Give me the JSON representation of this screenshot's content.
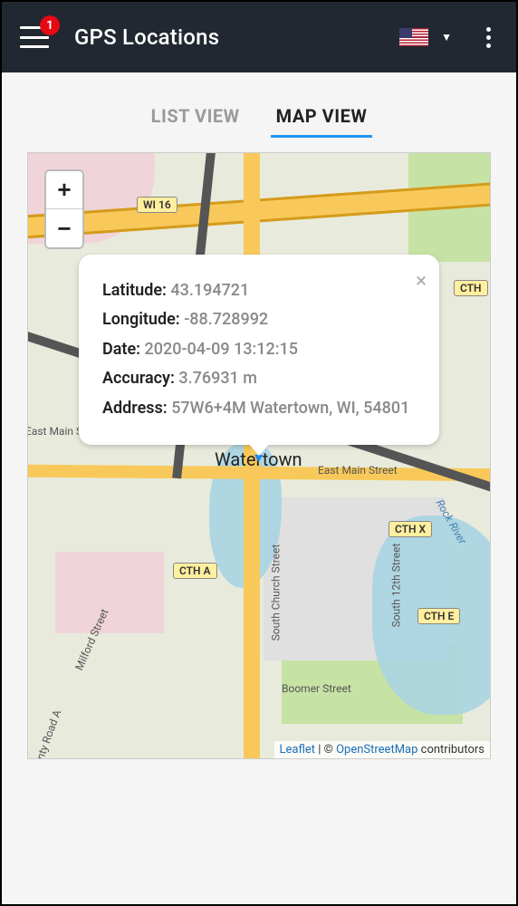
{
  "header": {
    "title": "GPS Locations",
    "badge": "1"
  },
  "tabs": {
    "list": "LIST VIEW",
    "map": "MAP VIEW"
  },
  "zoom": {
    "in": "+",
    "out": "−"
  },
  "popup": {
    "lat_label": "Latitude:",
    "lat_value": "43.194721",
    "lon_label": "Longitude:",
    "lon_value": "-88.728992",
    "date_label": "Date:",
    "date_value": "2020-04-09 13:12:15",
    "acc_label": "Accuracy:",
    "acc_value": "3.76931 m",
    "addr_label": "Address:",
    "addr_value": "57W6+4M Watertown, WI, 54801",
    "close": "×"
  },
  "map_labels": {
    "town": "Watertown",
    "wi16": "WI 16",
    "ctha": "CTH A",
    "cthx": "CTH X",
    "cthe": "CTH E",
    "cthright": "CTH",
    "east_main": "East Main Street",
    "east_main2": "East Main Street",
    "boomer": "Boomer Street",
    "milford": "Milford Street",
    "church": "South Church Street",
    "s12": "South 12th Street",
    "rock": "Rock River",
    "county_rd": "nty Road A"
  },
  "attrib": {
    "leaflet": "Leaflet",
    "sep": " | © ",
    "osm": "OpenStreetMap",
    "suffix": " contributors"
  }
}
